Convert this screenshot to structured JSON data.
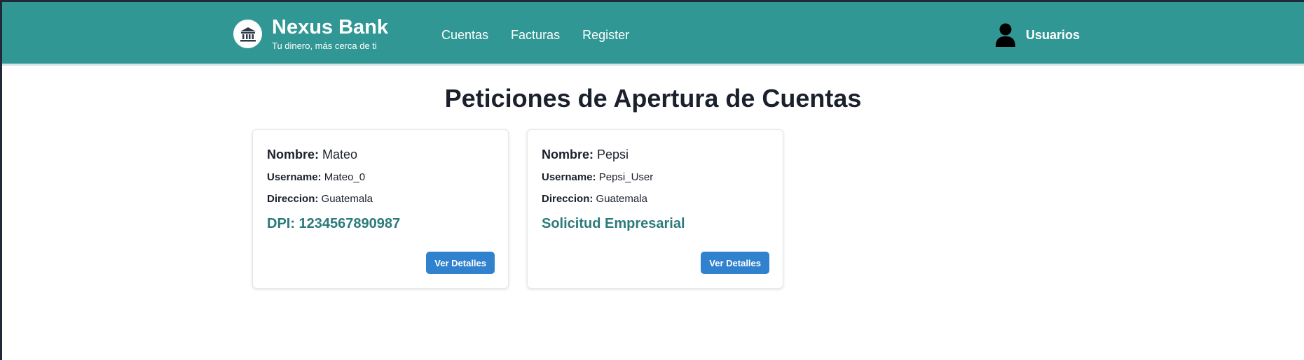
{
  "header": {
    "brand_name": "Nexus Bank",
    "tagline": "Tu dinero, más cerca de ti",
    "nav": [
      "Cuentas",
      "Facturas",
      "Register"
    ],
    "user_label": "Usuarios",
    "background_color": "#319795"
  },
  "main": {
    "title": "Peticiones de Apertura de Cuentas",
    "cards": [
      {
        "nombre_label": "Nombre:",
        "nombre": "Mateo",
        "username_label": "Username:",
        "username": "Mateo_0",
        "direccion_label": "Direccion:",
        "direccion": "Guatemala",
        "highlight": "DPI: 1234567890987",
        "button": "Ver Detalles"
      },
      {
        "nombre_label": "Nombre:",
        "nombre": "Pepsi",
        "username_label": "Username:",
        "username": "Pepsi_User",
        "direccion_label": "Direccion:",
        "direccion": "Guatemala",
        "highlight": "Solicitud Empresarial",
        "button": "Ver Detalles"
      }
    ],
    "highlight_color": "#2c7a7b",
    "button_color": "#3182ce"
  },
  "icons": {
    "logo": "bank-building-icon",
    "user": "user-icon"
  }
}
